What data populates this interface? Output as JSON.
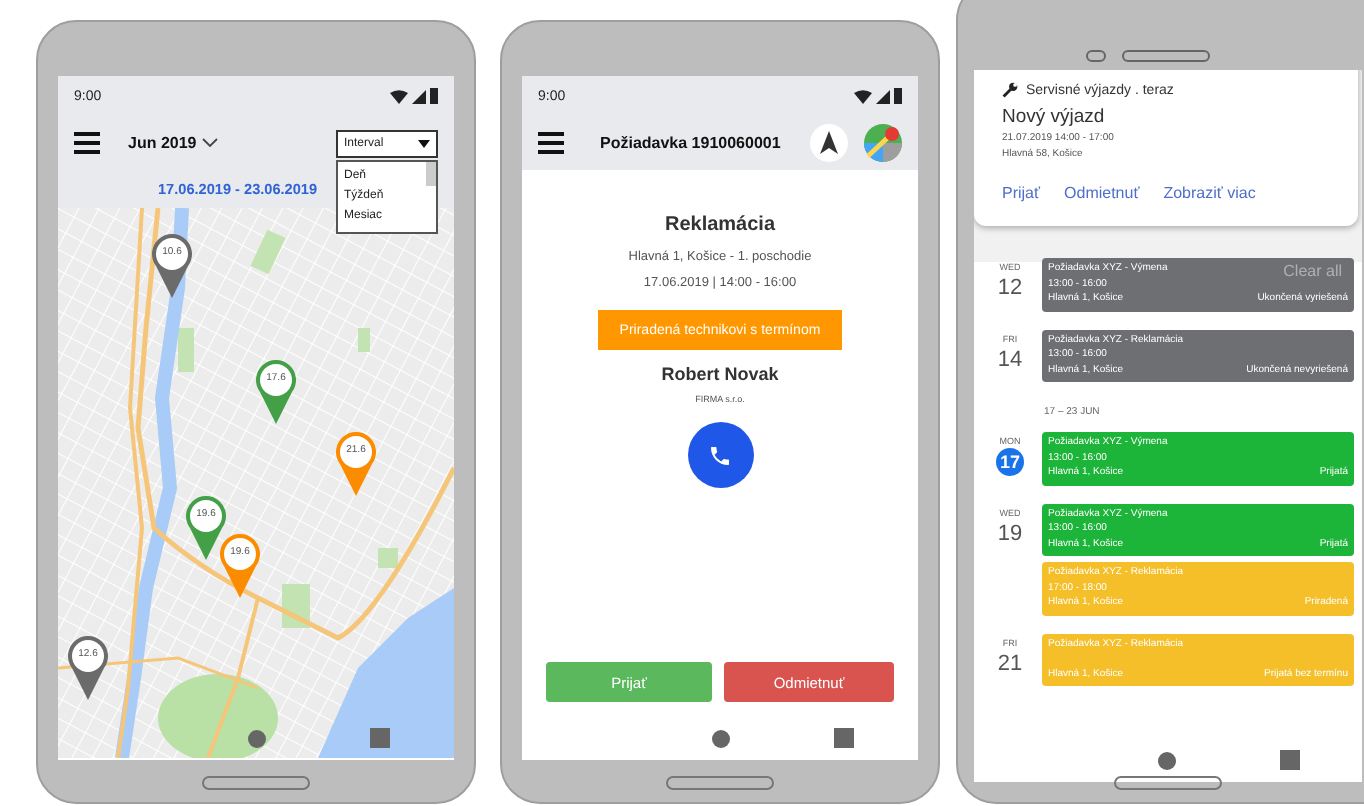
{
  "map_screen": {
    "status_time": "9:00",
    "month": "Jun 2019",
    "date_range": "17.06.2019 - 23.06.2019",
    "interval": {
      "value": "Interval",
      "expanded": true,
      "options": [
        "Deň",
        "Týždeň",
        "Mesiac"
      ]
    },
    "pins": [
      {
        "label": "10.6",
        "color": "#6b6b6b"
      },
      {
        "label": "17.6",
        "color": "#43a047"
      },
      {
        "label": "21.6",
        "color": "#fb8c00"
      },
      {
        "label": "19.6",
        "color": "#43a047"
      },
      {
        "label": "19.6",
        "color": "#fb8c00"
      },
      {
        "label": "12.6",
        "color": "#6b6b6b"
      }
    ]
  },
  "request_screen": {
    "status_time": "9:00",
    "title": "Požiadavka 1910060001",
    "type": "Reklamácia",
    "address": "Hlavná 1, Košice - 1. poschodie",
    "datetime": "17.06.2019 | 14:00 - 16:00",
    "status": "Priradená technikovi s termínom",
    "customer": "Robert Novak",
    "company": "FIRMA s.r.o.",
    "buttons": [
      {
        "label": "Prijať",
        "kind": "accept"
      },
      {
        "label": "Odmietnuť",
        "kind": "decline"
      }
    ]
  },
  "calendar_screen": {
    "notification": {
      "header": "Servisné výjazdy . teraz",
      "title": "Nový výjazd",
      "lines": [
        "21.07.2019 14:00 - 17:00",
        "Hlavná 58, Košice"
      ],
      "actions": [
        "Prijať",
        "Odmietnuť",
        "Zobraziť viac"
      ]
    },
    "clear_all": "Clear all",
    "items": [
      {
        "kind": "day",
        "weekday": "WED",
        "day": "12",
        "today": false,
        "events": [
          {
            "title": "Požiadavka XYZ - Výmena",
            "time": "13:00 - 16:00",
            "place": "Hlavná 1, Košice",
            "status": "Ukončená vyriešená",
            "color": "#6d6f73"
          }
        ]
      },
      {
        "kind": "day",
        "weekday": "FRI",
        "day": "14",
        "today": false,
        "events": [
          {
            "title": "Požiadavka XYZ - Reklamácia",
            "time": "13:00 - 16:00",
            "place": "Hlavná 1, Košice",
            "status": "Ukončená nevyriešená",
            "color": "#6d6f73"
          }
        ]
      },
      {
        "kind": "week",
        "label": "17 – 23 JUN"
      },
      {
        "kind": "day",
        "weekday": "MON",
        "day": "17",
        "today": true,
        "events": [
          {
            "title": "Požiadavka XYZ - Výmena",
            "time": "13:00 - 16:00",
            "place": "Hlavná 1, Košice",
            "status": "Prijatá",
            "color": "#1db43a"
          }
        ]
      },
      {
        "kind": "day",
        "weekday": "WED",
        "day": "19",
        "today": false,
        "events": [
          {
            "title": "Požiadavka XYZ - Výmena",
            "time": "13:00 - 16:00",
            "place": "Hlavná 1, Košice",
            "status": "Prijatá",
            "color": "#1db43a"
          },
          {
            "title": "Požiadavka XYZ - Reklamácia",
            "time": "17:00 - 18:00",
            "place": "Hlavná 1, Košice",
            "status": "Priradená",
            "color": "#f5bf2a"
          }
        ]
      },
      {
        "kind": "day",
        "weekday": "FRI",
        "day": "21",
        "today": false,
        "events": [
          {
            "title": "Požiadavka XYZ - Reklamácia",
            "place": "Hlavná 1, Košice",
            "status": "Prijatá bez termínu",
            "color": "#f5bf2a"
          }
        ]
      }
    ]
  }
}
